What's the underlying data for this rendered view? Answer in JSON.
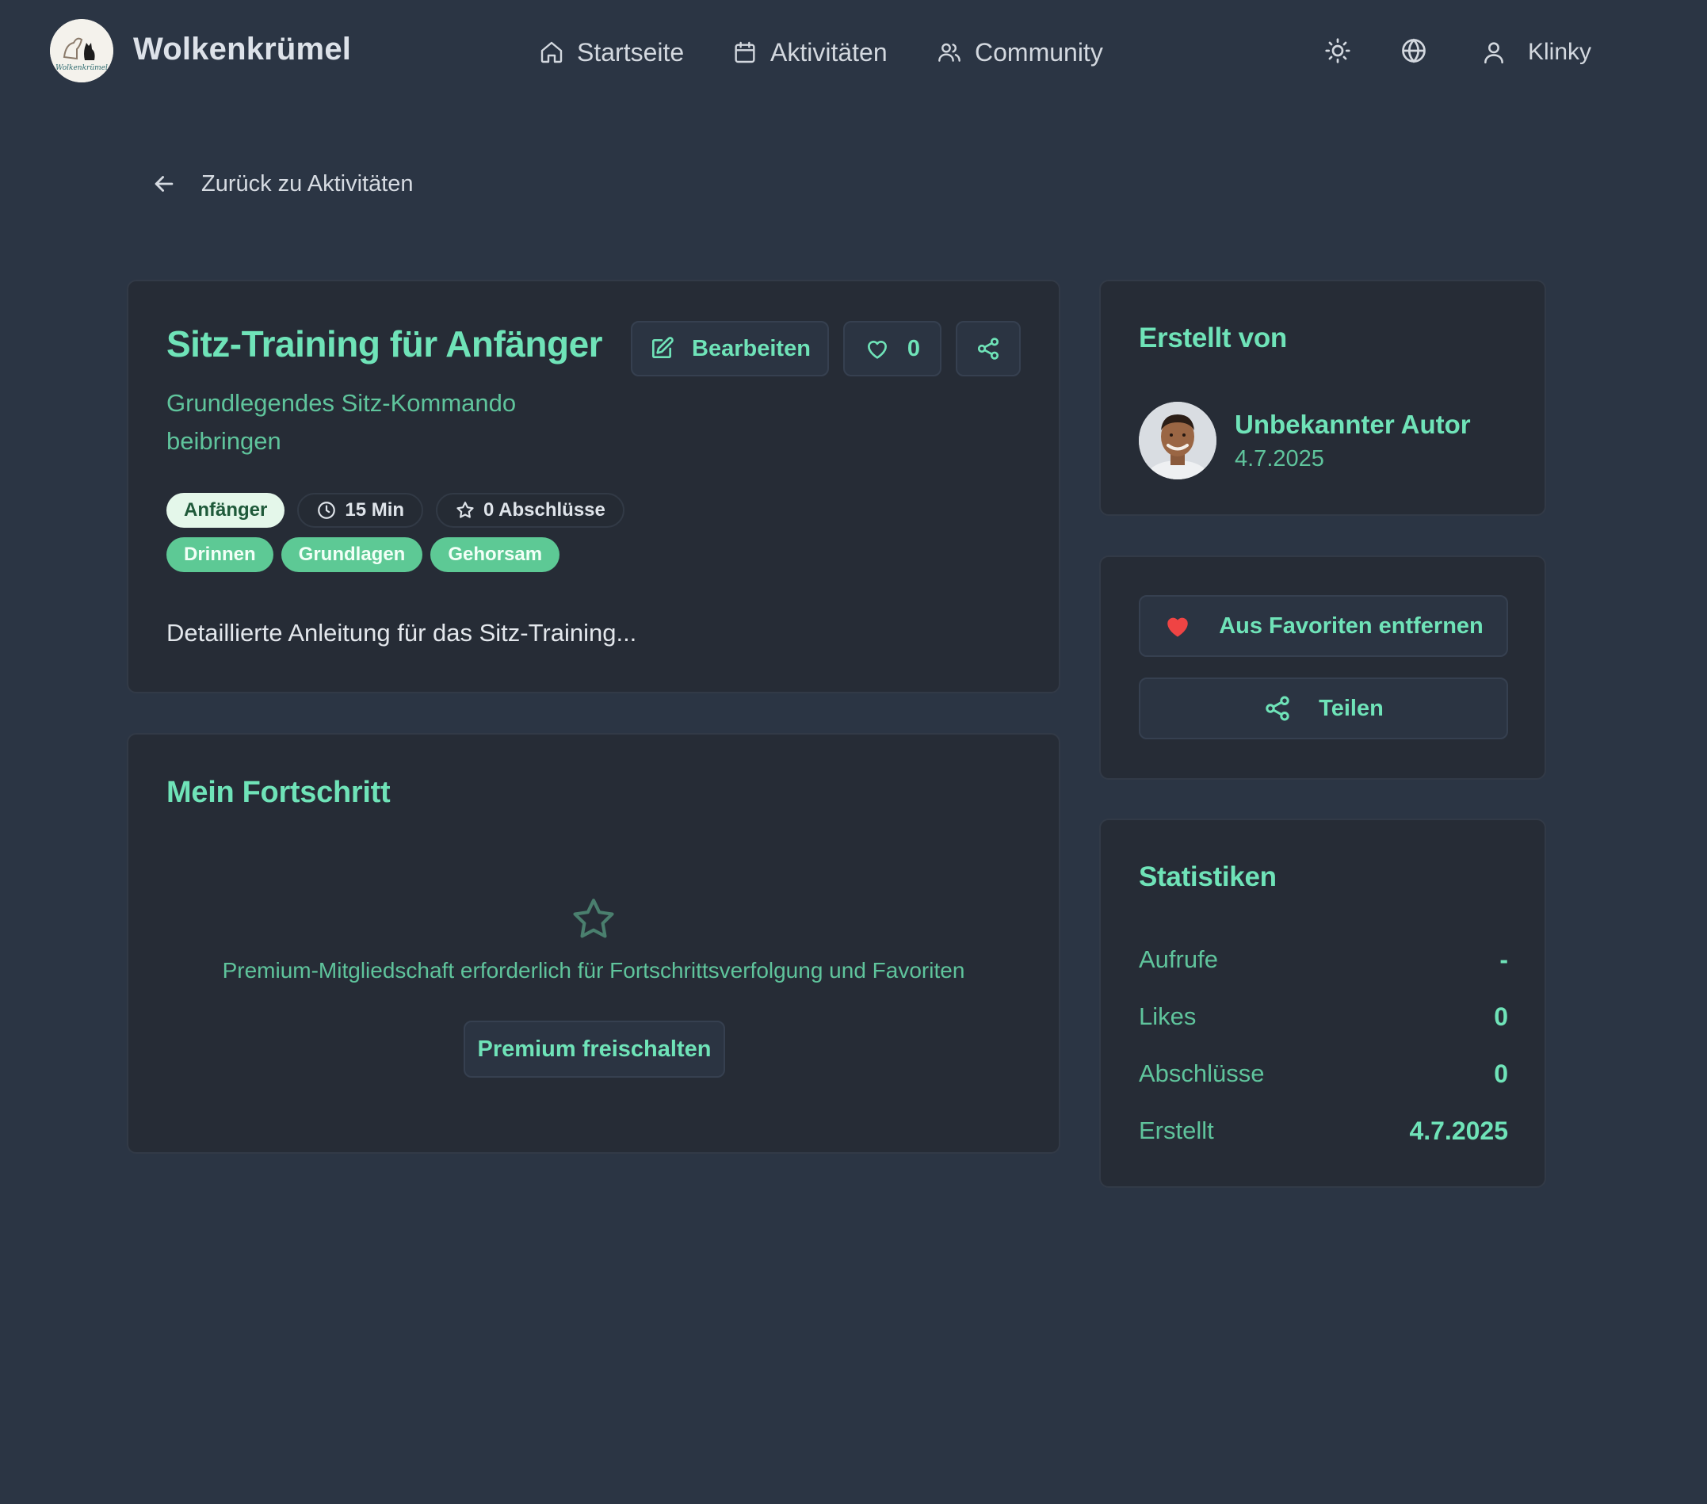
{
  "header": {
    "brand": "Wolkenkrümel",
    "logo_text": "Wolkenkrümel",
    "nav": [
      {
        "label": "Startseite",
        "icon": "home-icon"
      },
      {
        "label": "Aktivitäten",
        "icon": "calendar-icon"
      },
      {
        "label": "Community",
        "icon": "users-icon"
      }
    ],
    "theme_icon": "sun-icon",
    "language_icon": "globe-icon",
    "user": {
      "name": "Klinky",
      "icon": "user-icon"
    }
  },
  "back_link": {
    "label": "Zurück zu Aktivitäten",
    "icon": "arrow-left-icon"
  },
  "activity": {
    "title": "Sitz-Training für Anfänger",
    "subtitle": "Grundlegendes Sitz-Kommando beibringen",
    "edit_label": "Bearbeiten",
    "like_count": "0",
    "level": "Anfänger",
    "duration": "15 Min",
    "completions": "0 Abschlüsse",
    "tags": [
      "Drinnen",
      "Grundlagen",
      "Gehorsam"
    ],
    "description": "Detaillierte Anleitung für das Sitz-Training..."
  },
  "progress": {
    "title": "Mein Fortschritt",
    "premium_text": "Premium-Mitgliedschaft erforderlich für Fortschrittsverfolgung und Favoriten",
    "premium_button": "Premium freischalten"
  },
  "author": {
    "section_title": "Erstellt von",
    "name": "Unbekannter Autor",
    "date": "4.7.2025"
  },
  "actions": {
    "favorite_label": "Aus Favoriten entfernen",
    "share_label": "Teilen"
  },
  "stats": {
    "title": "Statistiken",
    "rows": [
      {
        "label": "Aufrufe",
        "value": "-"
      },
      {
        "label": "Likes",
        "value": "0"
      },
      {
        "label": "Abschlüsse",
        "value": "0"
      },
      {
        "label": "Erstellt",
        "value": "4.7.2025"
      }
    ]
  },
  "colors": {
    "background": "#2b3544",
    "card": "#262c36",
    "accent": "#6fe3b8",
    "accent_muted": "#5fc49c",
    "tag": "#5dc995",
    "heart": "#ef4444"
  }
}
